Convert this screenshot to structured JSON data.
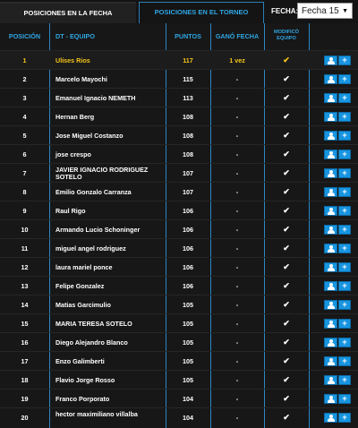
{
  "tabs": {
    "fecha": "POSICIONES EN LA FECHA",
    "torneo": "POSICIONES EN EL TORNEO"
  },
  "fecha_label": "FECHA:",
  "fecha_value": "Fecha 15",
  "headers": {
    "posicion": "POSICIÓN",
    "equipo": "DT - EQUIPO",
    "puntos": "PUNTOS",
    "gano": "GANÓ FECHA",
    "modifico_1": "MODIFICÓ",
    "modifico_2": "EQUIPO"
  },
  "rows": [
    {
      "pos": "1",
      "name": "Ulises Rios",
      "pts": "117",
      "gano": "1 vez"
    },
    {
      "pos": "2",
      "name": "Marcelo Mayochi",
      "pts": "115",
      "gano": "-"
    },
    {
      "pos": "3",
      "name": "Emanuel Ignacio NEMETH",
      "pts": "113",
      "gano": "-"
    },
    {
      "pos": "4",
      "name": "Hernan Berg",
      "pts": "108",
      "gano": "-"
    },
    {
      "pos": "5",
      "name": "Jose Miguel Costanzo",
      "pts": "108",
      "gano": "-"
    },
    {
      "pos": "6",
      "name": "jose crespo",
      "pts": "108",
      "gano": "-"
    },
    {
      "pos": "7",
      "name": "JAVIER IGNACIO RODRIGUEZ SOTELO",
      "pts": "107",
      "gano": "-"
    },
    {
      "pos": "8",
      "name": "Emilio Gonzalo Carranza",
      "pts": "107",
      "gano": "-"
    },
    {
      "pos": "9",
      "name": "Raul Rigo",
      "pts": "106",
      "gano": "-"
    },
    {
      "pos": "10",
      "name": "Armando Lucio Schoninger",
      "pts": "106",
      "gano": "-"
    },
    {
      "pos": "11",
      "name": "miguel angel rodriguez",
      "pts": "106",
      "gano": "-"
    },
    {
      "pos": "12",
      "name": "laura mariel ponce",
      "pts": "106",
      "gano": "-"
    },
    {
      "pos": "13",
      "name": "Felipe Gonzalez",
      "pts": "106",
      "gano": "-"
    },
    {
      "pos": "14",
      "name": "Matias Garcimulio",
      "pts": "105",
      "gano": "-"
    },
    {
      "pos": "15",
      "name": "MARIA TERESA SOTELO",
      "pts": "105",
      "gano": "-"
    },
    {
      "pos": "16",
      "name": "Diego Alejandro Blanco",
      "pts": "105",
      "gano": "-"
    },
    {
      "pos": "17",
      "name": "Enzo Galimberti",
      "pts": "105",
      "gano": "-"
    },
    {
      "pos": "18",
      "name": "Flavio Jorge Rosso",
      "pts": "105",
      "gano": "-"
    },
    {
      "pos": "19",
      "name": "Franco Porporato",
      "pts": "104",
      "gano": "-"
    },
    {
      "pos": "20",
      "name": "hector maximiliano villalba",
      "pts": "104",
      "gano": "-"
    }
  ],
  "check_glyph": "✔",
  "plus_glyph": "+",
  "icons": {
    "check": "check-icon",
    "user": "user-icon",
    "plus": "plus-icon"
  },
  "colors": {
    "accent": "#2fa6e3",
    "leader": "#f5c518",
    "check": "#5ec52c",
    "button": "#1795e0"
  }
}
